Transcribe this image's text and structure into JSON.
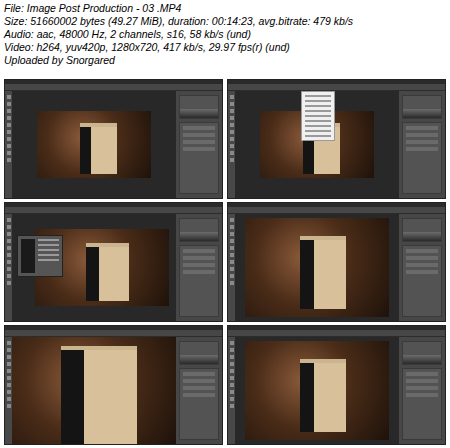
{
  "header": {
    "lines": [
      "File: Image Post Production - 03 .MP4",
      "Size: 51660002 bytes (49.27 MiB), duration: 00:14:23, avg.bitrate: 479 kb/s",
      "Audio: aac, 48000 Hz, 2 channels, s16, 58 kb/s (und)",
      "Video: h264, yuv420p, 1280x720, 417 kb/s, 29.97 fps(r) (und)",
      "Uploaded by Snorgared"
    ]
  },
  "frames": [
    {
      "kind": "windowed"
    },
    {
      "kind": "menu"
    },
    {
      "kind": "dialog"
    },
    {
      "kind": "fit"
    },
    {
      "kind": "zoom"
    },
    {
      "kind": "fit"
    }
  ]
}
